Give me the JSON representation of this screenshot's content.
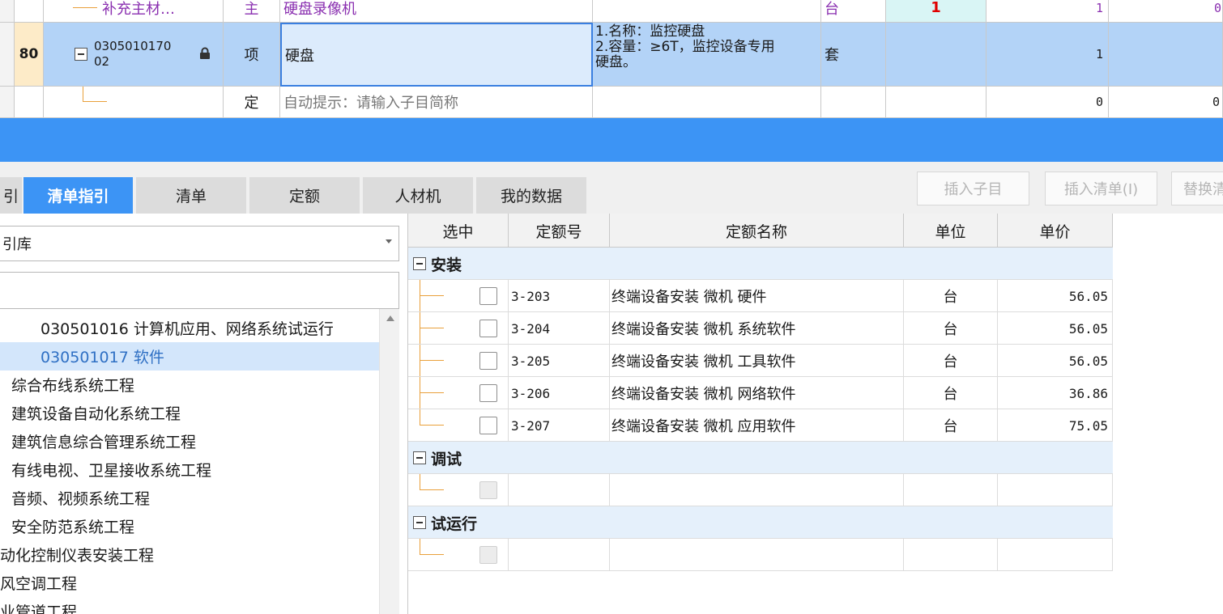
{
  "top_grid": {
    "row_partial": {
      "code": "补充主材…",
      "type": "主",
      "name": "硬盘录像机",
      "unit": "台",
      "qty_mark": "1",
      "amount": "1",
      "last": "0"
    },
    "row_selected": {
      "index": "80",
      "code_line1": "0305010170",
      "code_line2": "02",
      "type": "项",
      "name": "硬盘",
      "feature_line1": "1.名称：监控硬盘",
      "feature_line2": "2.容量：≥6T，监控设备专用",
      "feature_line3": "硬盘。",
      "unit": "套",
      "amount": "1"
    },
    "row_sub": {
      "type": "定",
      "name_hint": "自动提示：请输入子目简称",
      "amount": "0",
      "last": "0"
    }
  },
  "tabs": [
    {
      "label": "引",
      "active": false
    },
    {
      "label": "清单指引",
      "active": true
    },
    {
      "label": "清单",
      "active": false
    },
    {
      "label": "定额",
      "active": false
    },
    {
      "label": "人材机",
      "active": false
    },
    {
      "label": "我的数据",
      "active": false
    }
  ],
  "toolbar": {
    "insert_sub": "插入子目",
    "insert_list": "插入清单(I)",
    "replace": "替换清"
  },
  "left_panel": {
    "library_value": "引库",
    "search_value": "",
    "tree": [
      {
        "text": "030501016  计算机应用、网络系统试运行",
        "selected": false
      },
      {
        "text": "030501017  软件",
        "selected": true
      },
      {
        "text": "综合布线系统工程",
        "selected": false
      },
      {
        "text": "建筑设备自动化系统工程",
        "selected": false
      },
      {
        "text": "建筑信息综合管理系统工程",
        "selected": false
      },
      {
        "text": "有线电视、卫星接收系统工程",
        "selected": false
      },
      {
        "text": "音频、视频系统工程",
        "selected": false
      },
      {
        "text": "安全防范系统工程",
        "selected": false
      },
      {
        "text": "动化控制仪表安装工程",
        "selected": false
      },
      {
        "text": "风空调工程",
        "selected": false
      },
      {
        "text": "业管道工程",
        "selected": false
      }
    ]
  },
  "quota_table": {
    "headers": {
      "select": "选中",
      "code": "定额号",
      "name": "定额名称",
      "unit": "单位",
      "price": "单价"
    },
    "groups": [
      {
        "title": "安装",
        "rows": [
          {
            "code": "3-203",
            "name": "终端设备安装 微机 硬件",
            "unit": "台",
            "price": "56.05"
          },
          {
            "code": "3-204",
            "name": "终端设备安装 微机 系统软件",
            "unit": "台",
            "price": "56.05"
          },
          {
            "code": "3-205",
            "name": "终端设备安装 微机 工具软件",
            "unit": "台",
            "price": "56.05"
          },
          {
            "code": "3-206",
            "name": "终端设备安装 微机 网络软件",
            "unit": "台",
            "price": "36.86"
          },
          {
            "code": "3-207",
            "name": "终端设备安装 微机 应用软件",
            "unit": "台",
            "price": "75.05"
          }
        ]
      },
      {
        "title": "调试",
        "rows": []
      },
      {
        "title": "试运行",
        "rows": []
      }
    ]
  },
  "colors": {
    "accent": "#3c94f5",
    "selected_row": "#b3d3f7",
    "group_row": "#e5f0fb",
    "purple_text": "#8a2fb0",
    "red_mark": "#e00000",
    "tree_line": "#e9a03b"
  }
}
